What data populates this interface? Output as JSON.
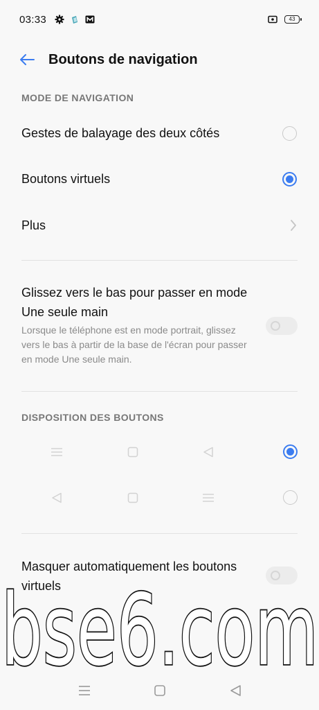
{
  "status_bar": {
    "time": "03:33",
    "left_icons": [
      "gear-icon",
      "app-icon",
      "mail-icon"
    ],
    "battery": "43"
  },
  "header": {
    "title": "Boutons de navigation",
    "back_icon": "arrow-left-icon"
  },
  "navigation_mode": {
    "section_title": "MODE DE NAVIGATION",
    "options": [
      {
        "label": "Gestes de balayage des deux côtés",
        "selected": false
      },
      {
        "label": "Boutons virtuels",
        "selected": true
      }
    ],
    "more_label": "Plus"
  },
  "one_hand": {
    "title": "Glissez vers le bas pour passer en mode Une seule main",
    "description": "Lorsque le téléphone est en mode portrait, glissez vers le bas à partir de la base de l'écran pour passer en mode Une seule main.",
    "enabled": false
  },
  "button_layout": {
    "section_title": "DISPOSITION DES BOUTONS",
    "options": [
      {
        "order": [
          "menu-icon",
          "square-icon",
          "back-triangle-icon"
        ],
        "selected": true
      },
      {
        "order": [
          "back-triangle-icon",
          "square-icon",
          "menu-icon"
        ],
        "selected": false
      }
    ]
  },
  "auto_hide": {
    "title": "Masquer automatiquement les boutons virtuels",
    "enabled": false
  },
  "nav_bar": {
    "buttons": [
      "menu-icon",
      "home-square-icon",
      "back-triangle-icon"
    ]
  },
  "watermark": {
    "text": "bse6.com"
  },
  "colors": {
    "accent": "#3b7cf0",
    "background": "#f8f8f8",
    "secondary_text": "#8a8a8a"
  }
}
